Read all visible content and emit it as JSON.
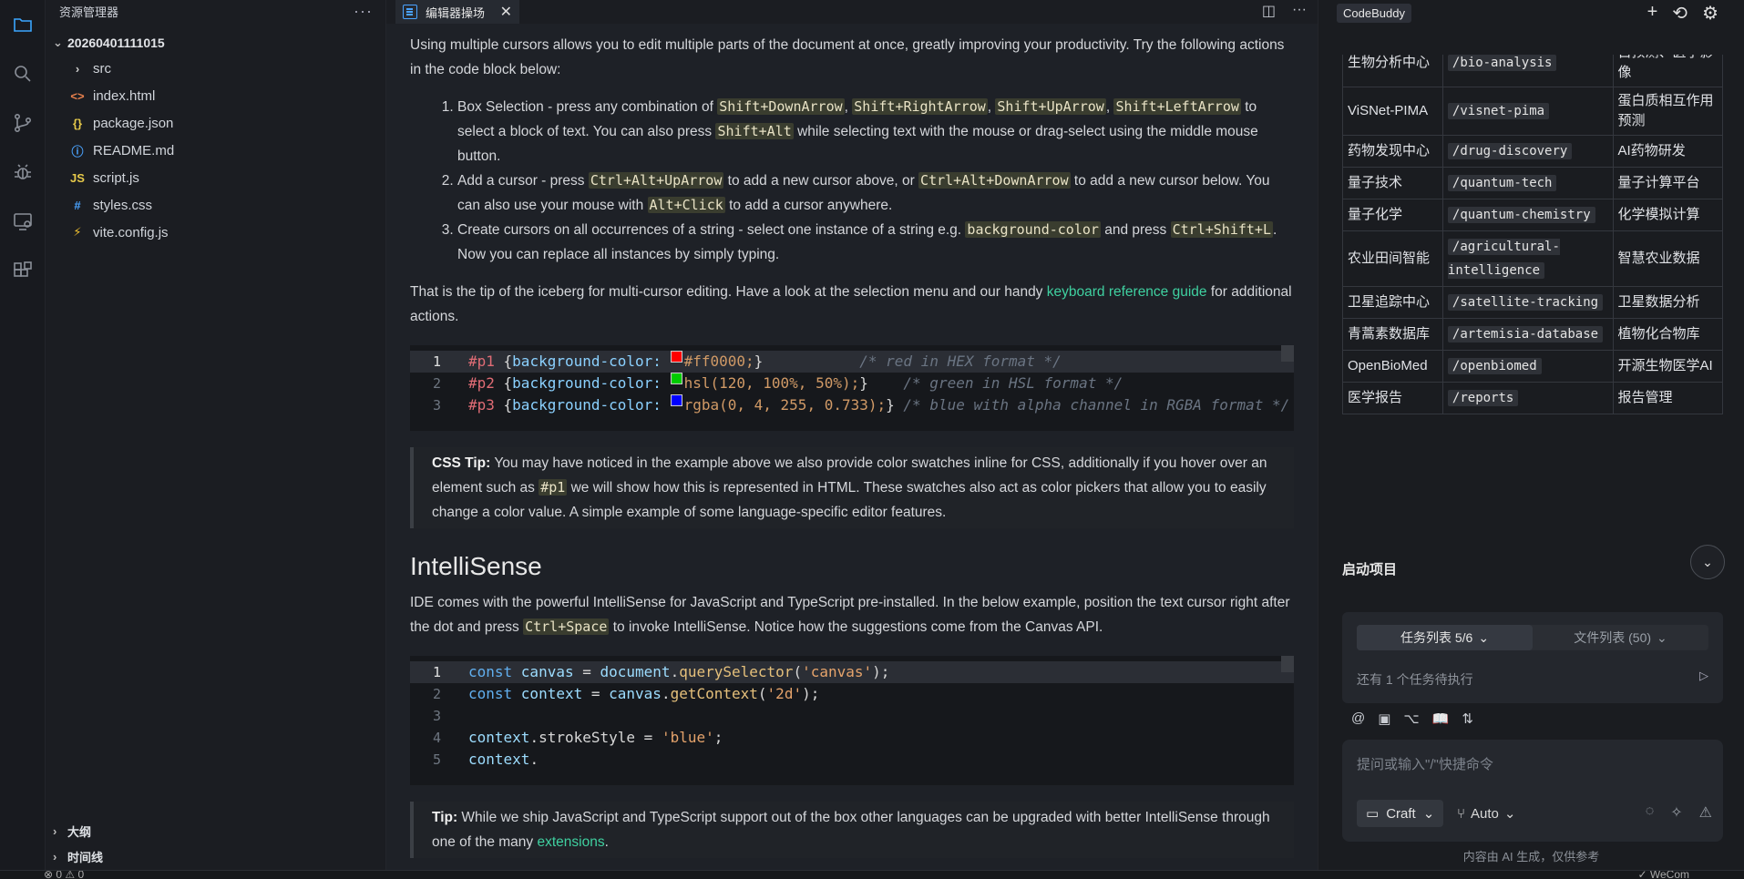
{
  "explorer": {
    "title": "资源管理器",
    "more": "···",
    "root": "20260401111015",
    "items": [
      {
        "name": "src",
        "icon": "folder",
        "glyph": "›",
        "color": "#cccccc"
      },
      {
        "name": "index.html",
        "icon": "html-file",
        "glyph": "<>",
        "color": "#e8804d"
      },
      {
        "name": "package.json",
        "icon": "json-file",
        "glyph": "{}",
        "color": "#e6c94a"
      },
      {
        "name": "README.md",
        "icon": "info-file",
        "glyph": "ⓘ",
        "color": "#4aa3ff"
      },
      {
        "name": "script.js",
        "icon": "js-file",
        "glyph": "JS",
        "color": "#e6c94a"
      },
      {
        "name": "styles.css",
        "icon": "css-file",
        "glyph": "#",
        "color": "#4aa3ff"
      },
      {
        "name": "vite.config.js",
        "icon": "vite-file",
        "glyph": "⚡",
        "color": "#f0c030"
      }
    ],
    "outline": "大纲",
    "timeline": "时间线"
  },
  "tabs": [
    {
      "label": "编辑器操场"
    }
  ],
  "doc": {
    "intro": "Using multiple cursors allows you to edit multiple parts of the document at once, greatly improving your productivity. Try the following actions in the code block below:",
    "li1": {
      "a": "Box Selection - press any combination of ",
      "k1": "Shift+DownArrow",
      "s1": ", ",
      "k2": "Shift+RightArrow",
      "s2": ", ",
      "k3": "Shift+UpArrow",
      "s3": ", ",
      "k4": "Shift+LeftArrow",
      "b": " to select a block of text. You can also press ",
      "k5": "Shift+Alt",
      "c": " while selecting text with the mouse or drag-select using the middle mouse button."
    },
    "li2": {
      "a": "Add a cursor - press ",
      "k1": "Ctrl+Alt+UpArrow",
      "b": " to add a new cursor above, or ",
      "k2": "Ctrl+Alt+DownArrow",
      "c": " to add a new cursor below. You can also use your mouse with ",
      "k3": "Alt+Click",
      "d": " to add a cursor anywhere."
    },
    "li3": {
      "a": "Create cursors on all occurrences of a string - select one instance of a string e.g. ",
      "k1": "background-color",
      "b": " and press ",
      "k2": "Ctrl+Shift+L",
      "c": ". Now you can replace all instances by simply typing."
    },
    "tip1": {
      "a": "That is the tip of the iceberg for multi-cursor editing. Have a look at the selection menu and our handy ",
      "link": "keyboard reference guide",
      "b": " for additional actions."
    },
    "css_lines": [
      {
        "n": "1",
        "sel": "#p1",
        "prop": "background-color:",
        "swatch": "#ff0000",
        "val": "#ff0000;",
        "cmt": "/* red in HEX format */"
      },
      {
        "n": "2",
        "sel": "#p2",
        "prop": "background-color:",
        "swatch": "#00cc00",
        "val": "hsl(120, 100%, 50%);",
        "cmt": "/* green in HSL format */"
      },
      {
        "n": "3",
        "sel": "#p3",
        "prop": "background-color:",
        "swatch": "#0000ff",
        "val": "rgba(0, 4, 255, 0.733);",
        "cmt": "/* blue with alpha channel in RGBA format */"
      }
    ],
    "csstip": {
      "label": "CSS Tip:",
      "a": " You may have noticed in the example above we also provide color swatches inline for CSS, additionally if you hover over an element such as ",
      "k": "#p1",
      "b": " we will show how this is represented in HTML. These swatches also act as color pickers that allow you to easily change a color value. A simple example of some language-specific editor features."
    },
    "h2": "IntelliSense",
    "isense": {
      "a": "IDE comes with the powerful IntelliSense for JavaScript and TypeScript pre-installed. In the below example, position the text cursor right after the dot and press ",
      "k": "Ctrl+Space",
      "b": " to invoke IntelliSense. Notice how the suggestions come from the Canvas API."
    },
    "js_lines": [
      "1",
      "2",
      "3",
      "4",
      "5"
    ],
    "tip2": {
      "label": "Tip:",
      "a": " While we ship JavaScript and TypeScript support out of the box other languages can be upgraded with better IntelliSense through one of the many ",
      "link": "extensions",
      "b": "."
    }
  },
  "right": {
    "badge": "CodeBuddy",
    "table": [
      {
        "name": "生物分析中心",
        "path": "/bio-analysis",
        "desc": "自预测、医学影像"
      },
      {
        "name": "ViSNet-PIMA",
        "path": "/visnet-pima",
        "desc": "蛋白质相互作用预测"
      },
      {
        "name": "药物发现中心",
        "path": "/drug-discovery",
        "desc": "AI药物研发"
      },
      {
        "name": "量子技术",
        "path": "/quantum-tech",
        "desc": "量子计算平台"
      },
      {
        "name": "量子化学",
        "path": "/quantum-chemistry",
        "desc": "化学模拟计算"
      },
      {
        "name": "农业田间智能",
        "path": "/agricultural-intelligence",
        "desc": "智慧农业数据"
      },
      {
        "name": "卫星追踪中心",
        "path": "/satellite-tracking",
        "desc": "卫星数据分析"
      },
      {
        "name": "青蒿素数据库",
        "path": "/artemisia-database",
        "desc": "植物化合物库"
      },
      {
        "name": "OpenBioMed",
        "path": "/openbiomed",
        "desc": "开源生物医学AI"
      },
      {
        "name": "医学报告",
        "path": "/reports",
        "desc": "报告管理"
      }
    ],
    "section": "启动项目",
    "task_tab": "任务列表 5/6",
    "file_tab": "文件列表 (50)",
    "task_note": "还有 1 个任务待执行",
    "input_placeholder": "提问或输入\"/\"快捷命令",
    "mode": "Craft",
    "auto": "Auto",
    "disclaimer": "内容由 AI 生成，仅供参考"
  },
  "status": {
    "left": "⊗ 0 ⚠ 0",
    "right": "✓ WeCom"
  }
}
